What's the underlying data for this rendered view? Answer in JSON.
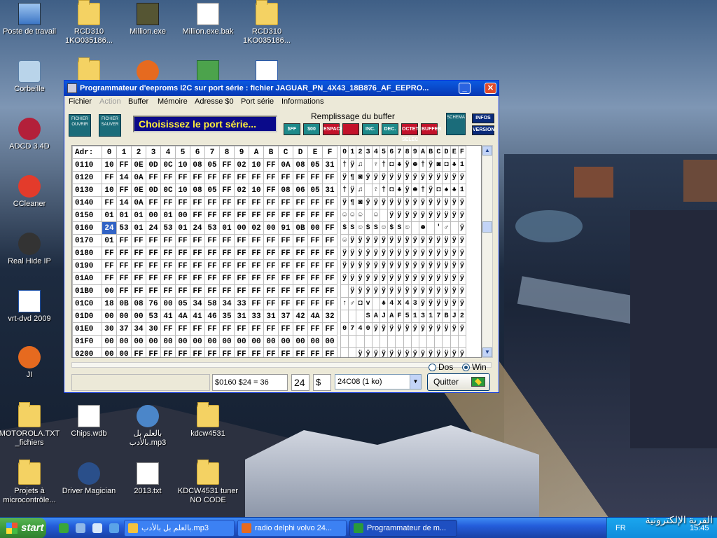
{
  "desktop_icons": [
    {
      "label": "Poste de travail",
      "icon": "computer-icon",
      "kind": "pc"
    },
    {
      "label": "RCD310 1KO035186...",
      "icon": "folder-icon",
      "kind": "folder"
    },
    {
      "label": "Million.exe",
      "icon": "avatar-icon",
      "kind": "avatar"
    },
    {
      "label": "Million.exe.bak",
      "icon": "file-icon",
      "kind": "file"
    },
    {
      "label": "RCD310 1KO035186...",
      "icon": "folder-icon",
      "kind": "folder"
    },
    {
      "label": "Corbeille",
      "icon": "recycle-bin-icon",
      "kind": "recycle"
    },
    {
      "label": "ADCD 3.4D",
      "icon": "app-icon",
      "kind": "circ"
    },
    {
      "label": "CCleaner",
      "icon": "ccleaner-icon",
      "kind": "circ"
    },
    {
      "label": "Real Hide IP",
      "icon": "spy-icon",
      "kind": "circ"
    },
    {
      "label": "vrt-dvd 2009",
      "icon": "dvd-icon",
      "kind": "file"
    },
    {
      "label": "JI",
      "icon": "firefox-icon",
      "kind": "circ"
    },
    {
      "label": "MOTOROLA.TXT _fichiers",
      "icon": "folder-icon",
      "kind": "folder"
    },
    {
      "label": "Chips.wdb",
      "icon": "file-icon",
      "kind": "file"
    },
    {
      "label": "بالعلم بل بالأدب.mp3",
      "icon": "media-icon",
      "kind": "circ"
    },
    {
      "label": "kdcw4531",
      "icon": "folder-icon",
      "kind": "folder"
    },
    {
      "label": "Projets à microcontrôle...",
      "icon": "folder-icon",
      "kind": "folder"
    },
    {
      "label": "Driver Magician",
      "icon": "magician-icon",
      "kind": "circ"
    },
    {
      "label": "2013.txt",
      "icon": "text-file-icon",
      "kind": "file"
    },
    {
      "label": "KDCW4531 tuner NO CODE",
      "icon": "folder-icon",
      "kind": "folder"
    }
  ],
  "window": {
    "title": "Programmateur d'eeproms I2C sur port série : fichier JAGUAR_PN_4X43_18B876_AF_EEPRO...",
    "menu": [
      "Fichier",
      "Action",
      "Buffer",
      "Mémoire",
      "Adresse $0",
      "Port série",
      "Informations"
    ],
    "toolbar": {
      "open_label": "FICHIER OUVRIR",
      "save_label": "FICHIER SAUVER",
      "port_prompt": "Choisissez le port série...",
      "fill_title": "Remplissage du buffer",
      "fill_buttons": [
        "$FF",
        "$00",
        "ESPACE",
        "",
        "INC.",
        "DEC.",
        "OCTET SELEC",
        "BUFFER"
      ],
      "schema_label": "SCHEMA",
      "infos_label": "INFOS",
      "version_label": "VERSION"
    },
    "grid": {
      "header": {
        "adr": "Adr:",
        "hex_cols": [
          "0",
          "1",
          "2",
          "3",
          "4",
          "5",
          "6",
          "7",
          "8",
          "9",
          "A",
          "B",
          "C",
          "D",
          "E",
          "F"
        ],
        "ascii_cols": [
          "0",
          "1",
          "2",
          "3",
          "4",
          "5",
          "6",
          "7",
          "8",
          "9",
          "A",
          "B",
          "C",
          "D",
          "E",
          "F"
        ]
      },
      "rows": [
        {
          "adr": "0110",
          "hex": [
            "10",
            "FF",
            "0E",
            "0D",
            "0C",
            "10",
            "08",
            "05",
            "FF",
            "02",
            "10",
            "FF",
            "0A",
            "08",
            "05",
            "31"
          ],
          "ascii": [
            "†",
            "ÿ",
            "♫",
            "",
            "♀",
            "†",
            "◘",
            "♣",
            "ÿ",
            "☻",
            "†",
            "ÿ",
            "◙",
            "◘",
            "♣",
            "1"
          ]
        },
        {
          "adr": "0120",
          "hex": [
            "FF",
            "14",
            "0A",
            "FF",
            "FF",
            "FF",
            "FF",
            "FF",
            "FF",
            "FF",
            "FF",
            "FF",
            "FF",
            "FF",
            "FF",
            "FF"
          ],
          "ascii": [
            "ÿ",
            "¶",
            "◙",
            "ÿ",
            "ÿ",
            "ÿ",
            "ÿ",
            "ÿ",
            "ÿ",
            "ÿ",
            "ÿ",
            "ÿ",
            "ÿ",
            "ÿ",
            "ÿ",
            "ÿ"
          ]
        },
        {
          "adr": "0130",
          "hex": [
            "10",
            "FF",
            "0E",
            "0D",
            "0C",
            "10",
            "08",
            "05",
            "FF",
            "02",
            "10",
            "FF",
            "08",
            "06",
            "05",
            "31"
          ],
          "ascii": [
            "†",
            "ÿ",
            "♫",
            "",
            "♀",
            "†",
            "◘",
            "♣",
            "ÿ",
            "☻",
            "†",
            "ÿ",
            "◘",
            "♠",
            "♣",
            "1"
          ]
        },
        {
          "adr": "0140",
          "hex": [
            "FF",
            "14",
            "0A",
            "FF",
            "FF",
            "FF",
            "FF",
            "FF",
            "FF",
            "FF",
            "FF",
            "FF",
            "FF",
            "FF",
            "FF",
            "FF"
          ],
          "ascii": [
            "ÿ",
            "¶",
            "◙",
            "ÿ",
            "ÿ",
            "ÿ",
            "ÿ",
            "ÿ",
            "ÿ",
            "ÿ",
            "ÿ",
            "ÿ",
            "ÿ",
            "ÿ",
            "ÿ",
            "ÿ"
          ]
        },
        {
          "adr": "0150",
          "hex": [
            "01",
            "01",
            "01",
            "00",
            "01",
            "00",
            "FF",
            "FF",
            "FF",
            "FF",
            "FF",
            "FF",
            "FF",
            "FF",
            "FF",
            "FF"
          ],
          "ascii": [
            "☺",
            "☺",
            "☺",
            "",
            "☺",
            "",
            "ÿ",
            "ÿ",
            "ÿ",
            "ÿ",
            "ÿ",
            "ÿ",
            "ÿ",
            "ÿ",
            "ÿ",
            "ÿ"
          ]
        },
        {
          "adr": "0160",
          "hex": [
            "24",
            "53",
            "01",
            "24",
            "53",
            "01",
            "24",
            "53",
            "01",
            "00",
            "02",
            "00",
            "91",
            "0B",
            "00",
            "FF"
          ],
          "ascii": [
            "$",
            "S",
            "☺",
            "$",
            "S",
            "☺",
            "$",
            "S",
            "☺",
            "",
            "☻",
            "",
            "'",
            "♂",
            "",
            "ÿ"
          ]
        },
        {
          "adr": "0170",
          "hex": [
            "01",
            "FF",
            "FF",
            "FF",
            "FF",
            "FF",
            "FF",
            "FF",
            "FF",
            "FF",
            "FF",
            "FF",
            "FF",
            "FF",
            "FF",
            "FF"
          ],
          "ascii": [
            "☺",
            "ÿ",
            "ÿ",
            "ÿ",
            "ÿ",
            "ÿ",
            "ÿ",
            "ÿ",
            "ÿ",
            "ÿ",
            "ÿ",
            "ÿ",
            "ÿ",
            "ÿ",
            "ÿ",
            "ÿ"
          ]
        },
        {
          "adr": "0180",
          "hex": [
            "FF",
            "FF",
            "FF",
            "FF",
            "FF",
            "FF",
            "FF",
            "FF",
            "FF",
            "FF",
            "FF",
            "FF",
            "FF",
            "FF",
            "FF",
            "FF"
          ],
          "ascii": [
            "ÿ",
            "ÿ",
            "ÿ",
            "ÿ",
            "ÿ",
            "ÿ",
            "ÿ",
            "ÿ",
            "ÿ",
            "ÿ",
            "ÿ",
            "ÿ",
            "ÿ",
            "ÿ",
            "ÿ",
            "ÿ"
          ]
        },
        {
          "adr": "0190",
          "hex": [
            "FF",
            "FF",
            "FF",
            "FF",
            "FF",
            "FF",
            "FF",
            "FF",
            "FF",
            "FF",
            "FF",
            "FF",
            "FF",
            "FF",
            "FF",
            "FF"
          ],
          "ascii": [
            "ÿ",
            "ÿ",
            "ÿ",
            "ÿ",
            "ÿ",
            "ÿ",
            "ÿ",
            "ÿ",
            "ÿ",
            "ÿ",
            "ÿ",
            "ÿ",
            "ÿ",
            "ÿ",
            "ÿ",
            "ÿ"
          ]
        },
        {
          "adr": "01A0",
          "hex": [
            "FF",
            "FF",
            "FF",
            "FF",
            "FF",
            "FF",
            "FF",
            "FF",
            "FF",
            "FF",
            "FF",
            "FF",
            "FF",
            "FF",
            "FF",
            "FF"
          ],
          "ascii": [
            "ÿ",
            "ÿ",
            "ÿ",
            "ÿ",
            "ÿ",
            "ÿ",
            "ÿ",
            "ÿ",
            "ÿ",
            "ÿ",
            "ÿ",
            "ÿ",
            "ÿ",
            "ÿ",
            "ÿ",
            "ÿ"
          ]
        },
        {
          "adr": "01B0",
          "hex": [
            "00",
            "FF",
            "FF",
            "FF",
            "FF",
            "FF",
            "FF",
            "FF",
            "FF",
            "FF",
            "FF",
            "FF",
            "FF",
            "FF",
            "FF",
            "FF"
          ],
          "ascii": [
            "",
            "ÿ",
            "ÿ",
            "ÿ",
            "ÿ",
            "ÿ",
            "ÿ",
            "ÿ",
            "ÿ",
            "ÿ",
            "ÿ",
            "ÿ",
            "ÿ",
            "ÿ",
            "ÿ",
            "ÿ"
          ]
        },
        {
          "adr": "01C0",
          "hex": [
            "18",
            "0B",
            "08",
            "76",
            "00",
            "05",
            "34",
            "58",
            "34",
            "33",
            "FF",
            "FF",
            "FF",
            "FF",
            "FF",
            "FF"
          ],
          "ascii": [
            "↑",
            "♂",
            "◘",
            "v",
            "",
            "♣",
            "4",
            "X",
            "4",
            "3",
            "ÿ",
            "ÿ",
            "ÿ",
            "ÿ",
            "ÿ",
            "ÿ"
          ]
        },
        {
          "adr": "01D0",
          "hex": [
            "00",
            "00",
            "00",
            "53",
            "41",
            "4A",
            "41",
            "46",
            "35",
            "31",
            "33",
            "31",
            "37",
            "42",
            "4A",
            "32"
          ],
          "ascii": [
            "",
            "",
            "",
            "S",
            "A",
            "J",
            "A",
            "F",
            "5",
            "1",
            "3",
            "1",
            "7",
            "B",
            "J",
            "2"
          ]
        },
        {
          "adr": "01E0",
          "hex": [
            "30",
            "37",
            "34",
            "30",
            "FF",
            "FF",
            "FF",
            "FF",
            "FF",
            "FF",
            "FF",
            "FF",
            "FF",
            "FF",
            "FF",
            "FF"
          ],
          "ascii": [
            "0",
            "7",
            "4",
            "0",
            "ÿ",
            "ÿ",
            "ÿ",
            "ÿ",
            "ÿ",
            "ÿ",
            "ÿ",
            "ÿ",
            "ÿ",
            "ÿ",
            "ÿ",
            "ÿ"
          ]
        },
        {
          "adr": "01F0",
          "hex": [
            "00",
            "00",
            "00",
            "00",
            "00",
            "00",
            "00",
            "00",
            "00",
            "00",
            "00",
            "00",
            "00",
            "00",
            "00",
            "00"
          ],
          "ascii": [
            "",
            "",
            "",
            "",
            "",
            "",
            "",
            "",
            "",
            "",
            "",
            "",
            "",
            "",
            "",
            ""
          ]
        },
        {
          "adr": "0200",
          "hex": [
            "00",
            "00",
            "FF",
            "FF",
            "FF",
            "FF",
            "FF",
            "FF",
            "FF",
            "FF",
            "FF",
            "FF",
            "FF",
            "FF",
            "FF",
            "FF"
          ],
          "ascii": [
            "",
            "",
            "ÿ",
            "ÿ",
            "ÿ",
            "ÿ",
            "ÿ",
            "ÿ",
            "ÿ",
            "ÿ",
            "ÿ",
            "ÿ",
            "ÿ",
            "ÿ",
            "ÿ",
            "ÿ"
          ]
        }
      ]
    },
    "radios": {
      "dos_label": "Dos",
      "win_label": "Win",
      "selected": "Win"
    },
    "status": {
      "info": "$0160   $24 = 36",
      "value_hex": "24",
      "value_prefix": "$",
      "device": "24C08 (1 ko)",
      "quit_label": "Quitter"
    }
  },
  "taskbar": {
    "start_label": "start",
    "tasks": [
      {
        "label": "بالعلم بل بالأدب.mp3",
        "active": false
      },
      {
        "label": "radio delphi volvo 24...",
        "active": false
      },
      {
        "label": "Programmateur de m...",
        "active": true
      }
    ],
    "lang": "FR",
    "clock": "15:45"
  },
  "watermark": "القرية الإلكترونية"
}
